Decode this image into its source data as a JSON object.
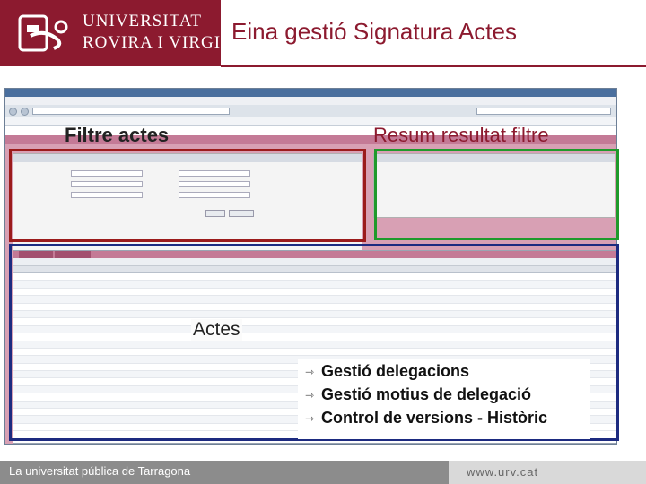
{
  "header": {
    "logo_line1": "UNIVERSITAT",
    "logo_line2": "ROVIRA I VIRGILI",
    "slide_title": "Eina gestió Signatura Actes"
  },
  "annotations": {
    "filter_label": "Filtre actes",
    "summary_label": "Resum resultat filtre",
    "actes_label": "Actes"
  },
  "callout": {
    "items": [
      "Gestió delegacions",
      "Gestió motius de delegació",
      "Control de versions - Històric"
    ]
  },
  "footer": {
    "tagline": "La universitat pública de Tarragona",
    "url": "www.urv.cat"
  },
  "colors": {
    "brand": "#8c1a2f",
    "filter_box": "#9b1b1b",
    "summary_box": "#1f9a2b",
    "actes_box": "#1d2b80",
    "app_background": "#d8a0b4"
  }
}
